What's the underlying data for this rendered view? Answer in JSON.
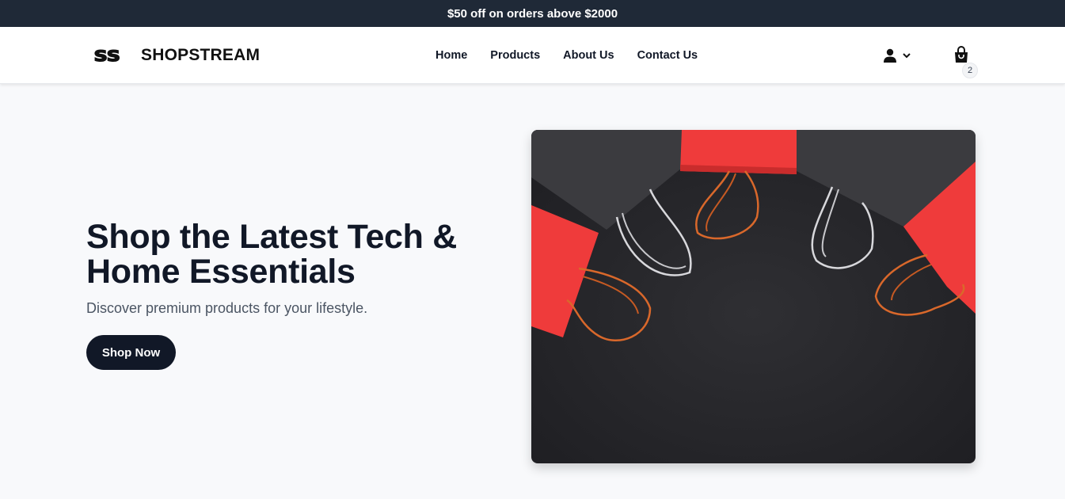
{
  "promo": {
    "text": "$50 off on orders above $2000"
  },
  "brand": {
    "logo_text": "SS",
    "name": "SHOPSTREAM"
  },
  "nav": {
    "items": [
      {
        "label": "Home"
      },
      {
        "label": "Products"
      },
      {
        "label": "About Us"
      },
      {
        "label": "Contact Us"
      }
    ]
  },
  "header": {
    "account_icon": "user-icon",
    "dropdown_icon": "chevron-down-icon",
    "cart_icon": "shopping-bag-icon",
    "cart_count": "2"
  },
  "hero": {
    "title": "Shop the Latest Tech & Home Essentials",
    "subtitle": "Discover premium products for your lifestyle.",
    "cta_label": "Shop Now",
    "image_description_icon": "shopping-bags-image"
  },
  "colors": {
    "promo_bg": "#1f2937",
    "cta_bg": "#111827",
    "accent_red": "#ef4444"
  }
}
